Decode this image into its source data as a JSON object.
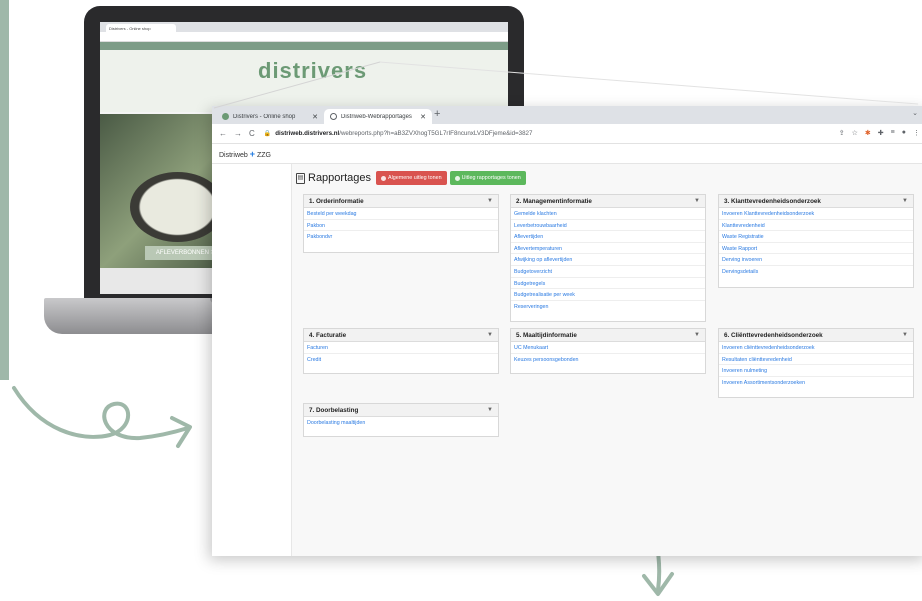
{
  "laptop": {
    "tab_title": "Distrivers - Online shop",
    "logo_text": "distrivers",
    "hero_button": "AFLEVERBONNEN >"
  },
  "browser": {
    "tabs": [
      {
        "label": "Distrivers - Online shop",
        "icon": "distrivers-favicon"
      },
      {
        "label": "Distriweb-Webrapportages",
        "icon": "globe-icon"
      }
    ],
    "new_tab": "+",
    "overflow": "⌄",
    "nav": {
      "back": "←",
      "forward": "→",
      "reload": "C"
    },
    "url_host": "distriweb.distrivers.nl",
    "url_path": "/webreports.php?h=aB3ZVXhogT5GL7rIF8ncunxLV3DFjeme&id=3827"
  },
  "app": {
    "brand_left": "Distriweb",
    "brand_plus": "+",
    "brand_right": "ZZG"
  },
  "page": {
    "title": "Rapportages",
    "btn_general": "Algemene uitleg tonen",
    "btn_reports": "Uitleg rapportages tonen"
  },
  "panels": [
    {
      "title": "1. Orderinformatie",
      "items": [
        "Besteld per weekdag",
        "Pakbon",
        "Pakbondvr"
      ]
    },
    {
      "title": "2. Managementinformatie",
      "items": [
        "Gemelde klachten",
        "Leverbetrouwbaarheid",
        "Aflevertijden",
        "Aflevertemperaturen",
        "Afwijking op aflevertijden",
        "Budgetoverzicht",
        "Budgetregels",
        "Budgetrealisatie per week",
        "Reserveringen"
      ]
    },
    {
      "title": "3. Klanttevredenheidsonderzoek",
      "items": [
        "Invoeren Klanttevredenheidsonderzoek",
        "Klanttevredenheid",
        "Waste Registratie",
        "Waste Rapport",
        "Derving invoeren",
        "Dervingsdetails"
      ]
    },
    {
      "title": "4. Facturatie",
      "items": [
        "Facturen",
        "Credit"
      ]
    },
    {
      "title": "5. Maaltijdinformatie",
      "items": [
        "UC Menukaart",
        "Keuzes persoonsgebonden"
      ]
    },
    {
      "title": "6. Cliënttevredenheidsonderzoek",
      "items": [
        "Invoeren cliënttevredenheidsonderzoek",
        "Resultaten cliënttevredenheid",
        "Invoeren nulmeting",
        "Invoeren Assortimentsonderzoeken"
      ]
    },
    {
      "title": "7. Doorbelasting",
      "items": [
        "Doorbelasting maaltijden"
      ]
    }
  ],
  "colors": {
    "brand_green": "#9fb8a9",
    "link_blue": "#2a7ae2",
    "btn_red": "#d9534f",
    "btn_green": "#5cb85c"
  }
}
